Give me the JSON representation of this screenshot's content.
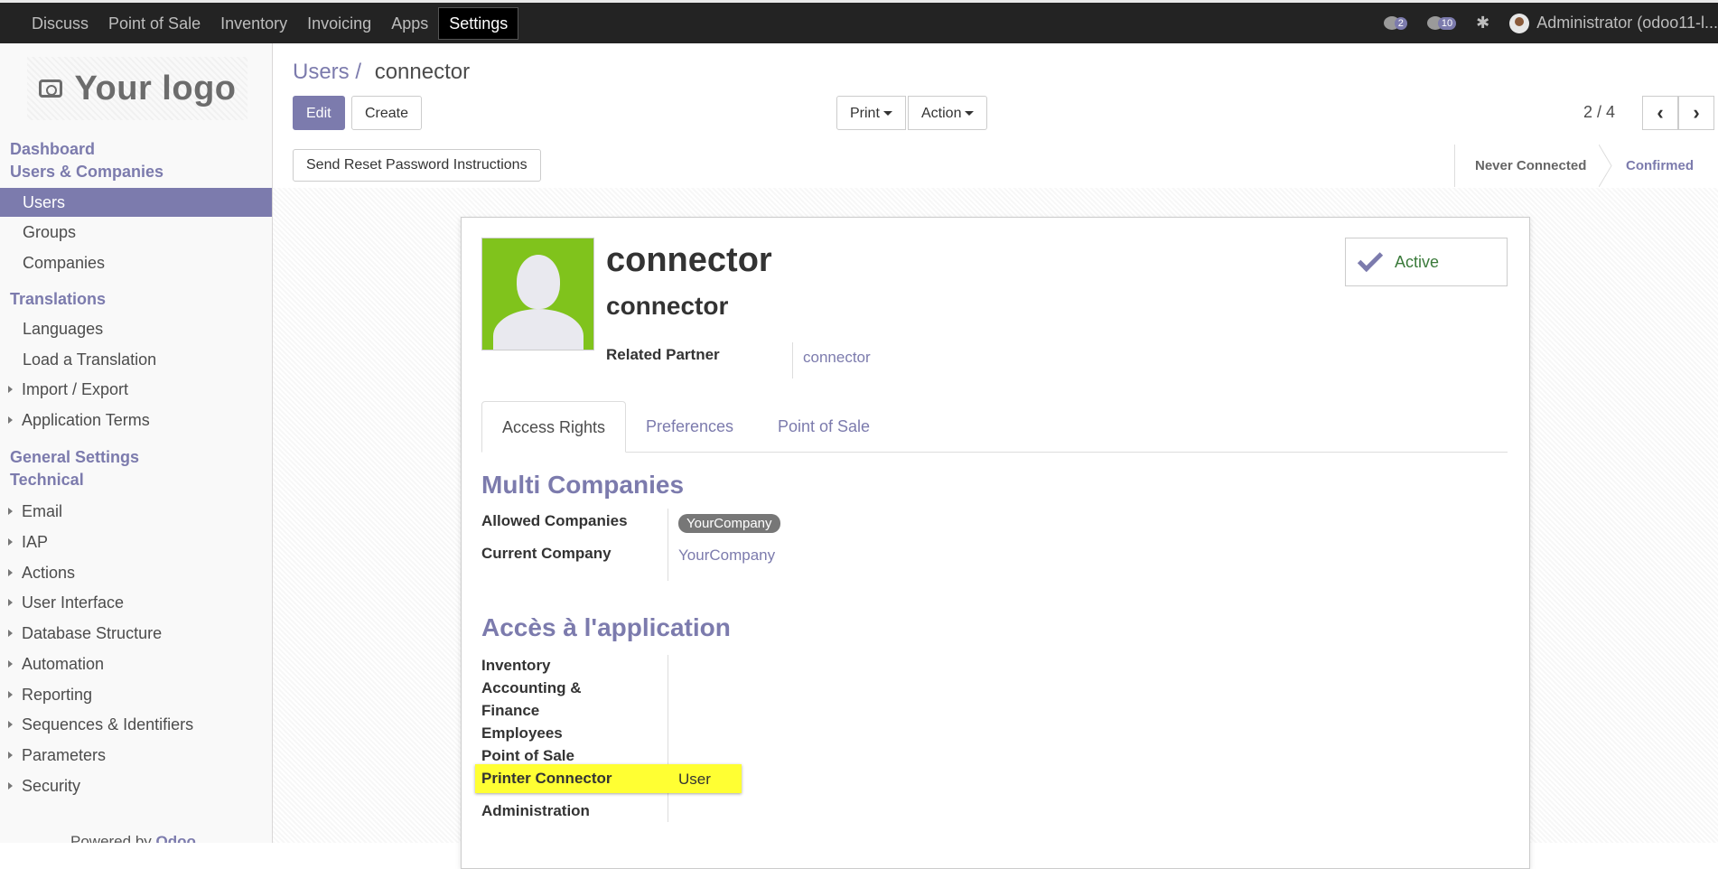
{
  "topbar": {
    "menu": [
      "Discuss",
      "Point of Sale",
      "Inventory",
      "Invoicing",
      "Apps",
      "Settings"
    ],
    "active": "Settings",
    "activity_count": "2",
    "message_count": "10",
    "user": "Administrator (odoo11-l..."
  },
  "sidebar": {
    "logo_text": "Your logo",
    "sections": {
      "dashboard": "Dashboard",
      "users_companies": "Users & Companies",
      "translations": "Translations",
      "general_settings": "General Settings",
      "technical": "Technical"
    },
    "users_items": [
      "Users",
      "Groups",
      "Companies"
    ],
    "translation_items": [
      "Languages",
      "Load a Translation",
      "Import / Export",
      "Application Terms"
    ],
    "technical_items": [
      "Email",
      "IAP",
      "Actions",
      "User Interface",
      "Database Structure",
      "Automation",
      "Reporting",
      "Sequences & Identifiers",
      "Parameters",
      "Security"
    ],
    "powered_prefix": "Powered by",
    "powered_brand": "Odoo"
  },
  "control_panel": {
    "breadcrumb_parent": "Users",
    "breadcrumb_sep": "/",
    "breadcrumb_current": "connector",
    "edit_label": "Edit",
    "create_label": "Create",
    "print_label": "Print",
    "action_label": "Action",
    "pager": "2 / 4"
  },
  "statusbar": {
    "reset_button": "Send Reset Password Instructions",
    "stages": [
      "Never Connected",
      "Confirmed"
    ],
    "current_stage": "Confirmed"
  },
  "form": {
    "login": "connector",
    "name": "connector",
    "related_partner_label": "Related Partner",
    "related_partner_value": "connector",
    "active_label": "Active",
    "tabs": [
      "Access Rights",
      "Preferences",
      "Point of Sale"
    ],
    "active_tab": "Access Rights",
    "multi_companies_title": "Multi Companies",
    "allowed_companies_label": "Allowed Companies",
    "allowed_companies_tag": "YourCompany",
    "current_company_label": "Current Company",
    "current_company_value": "YourCompany",
    "app_access_title": "Accès à l'application",
    "app_rows": {
      "inventory": "Inventory",
      "accounting_1": "Accounting &",
      "accounting_2": "Finance",
      "employees": "Employees",
      "point_of_sale": "Point of Sale",
      "printer_connector": "Printer Connector",
      "printer_connector_value": "User",
      "administration": "Administration"
    }
  }
}
